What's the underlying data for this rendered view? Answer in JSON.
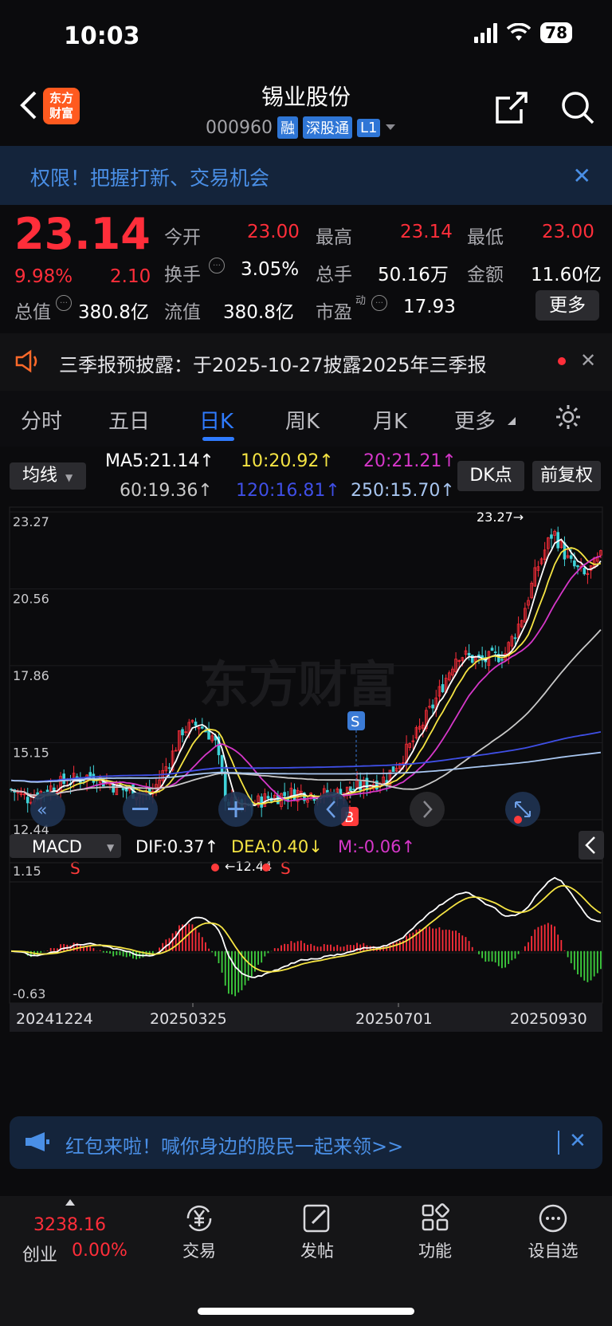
{
  "status": {
    "time": "10:03",
    "battery": "78"
  },
  "header": {
    "logo_line1": "东方",
    "logo_line2": "财富",
    "name": "锡业股份",
    "code": "000960",
    "tags": [
      "融",
      "深股通",
      "L1"
    ]
  },
  "banner": {
    "text": "权限！把握打新、交易机会"
  },
  "quote": {
    "price": "23.14",
    "pct": "9.98%",
    "chg": "2.10",
    "open_label": "今开",
    "open": "23.00",
    "high_label": "最高",
    "high": "23.14",
    "low_label": "最低",
    "low": "23.00",
    "turnover_label": "换手",
    "turnover": "3.05%",
    "volume_label": "总手",
    "volume": "50.16万",
    "amount_label": "金额",
    "amount": "11.60亿",
    "mktcap_label": "总值",
    "mktcap": "380.8亿",
    "float_label": "流值",
    "float": "380.8亿",
    "pe_label": "市盈",
    "pe_sup": "动",
    "pe": "17.93",
    "more_label": "更多"
  },
  "notice": {
    "text": "三季报预披露：于2025-10-27披露2025年三季报"
  },
  "tabs": [
    "分时",
    "五日",
    "日K",
    "周K",
    "月K",
    "更多"
  ],
  "active_tab": "日K",
  "indicator_bar": {
    "ma_select": "均线",
    "dk_label": "DK点",
    "adjust_label": "前复权",
    "ma5": "MA5:21.14↑",
    "ma10": "10:20.92↑",
    "ma20": "20:21.21↑",
    "ma60": "60:19.36↑",
    "ma120": "120:16.81↑",
    "ma250": "250:15.70↑"
  },
  "macd_bar": {
    "select": "MACD",
    "dif": "DIF:0.37↑",
    "dea": "DEA:0.40↓",
    "m": "M:-0.06↑"
  },
  "colors": {
    "ma5": "#ffffff",
    "ma10": "#f5e443",
    "ma20": "#d637c9",
    "ma60": "#c9c9c9",
    "ma120": "#3f4fe6",
    "ma250": "#a8c6f0",
    "up": "#ff2e3a",
    "down": "#3fd3d9"
  },
  "chart_data": {
    "type": "candlestick",
    "price_axis_labels": [
      "23.27",
      "20.56",
      "17.86",
      "15.15",
      "12.44"
    ],
    "ylim": [
      12.44,
      23.27
    ],
    "high_marker": "23.27→",
    "low_marker": "←12.44",
    "date_labels": [
      "20241224",
      "20250325",
      "20250701",
      "20250930"
    ],
    "macd_axis_labels": [
      "1.15",
      "-0.63"
    ],
    "macd_ylim": [
      -0.63,
      1.15
    ],
    "signal_marks": [
      "S",
      "S",
      "S",
      "B"
    ]
  },
  "banner2": {
    "text": "红包来啦！喊你身边的股民一起来领>>"
  },
  "bottom_nav": {
    "index_value": "3238.16",
    "index_name": "创业",
    "index_pct": "0.00%",
    "items": [
      "交易",
      "发帖",
      "功能",
      "设自选"
    ]
  }
}
